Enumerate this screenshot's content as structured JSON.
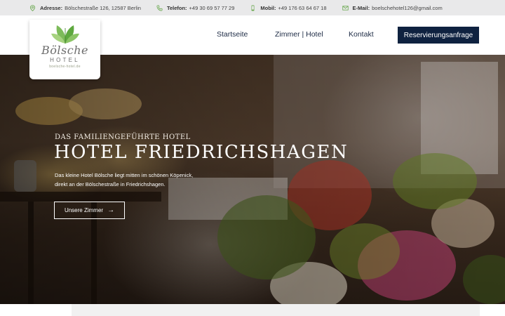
{
  "topbar": {
    "address_label": "Adresse:",
    "address_value": "Bölschestraße 126, 12587 Berlin",
    "phone_label": "Telefon:",
    "phone_value": "+49 30 69 57 77 29",
    "mobile_label": "Mobil:",
    "mobile_value": "+49 176 63 64 67 18",
    "email_label": "E-Mail:",
    "email_value": "boelschehotel126@gmail.com",
    "icon_color": "#6aa84f"
  },
  "logo": {
    "script": "Bölsche",
    "word": "HOTEL",
    "url": "boelsche-hotel.de"
  },
  "nav": {
    "items": [
      {
        "label": "Startseite"
      },
      {
        "label": "Zimmer | Hotel"
      },
      {
        "label": "Kontakt"
      }
    ],
    "cta_label": "Reservierungsanfrage",
    "cta_color": "#0f2240"
  },
  "hero": {
    "subtitle": "DAS FAMILIENGEFÜHRTE HOTEL",
    "title": "HOTEL FRIEDRICHSHAGEN",
    "text_line1": "Das kleine Hotel Bölsche liegt mitten im schönen Köpenick,",
    "text_line2": "direkt an der Bölschestraße in Friedrichshagen.",
    "button_label": "Unsere Zimmer"
  }
}
